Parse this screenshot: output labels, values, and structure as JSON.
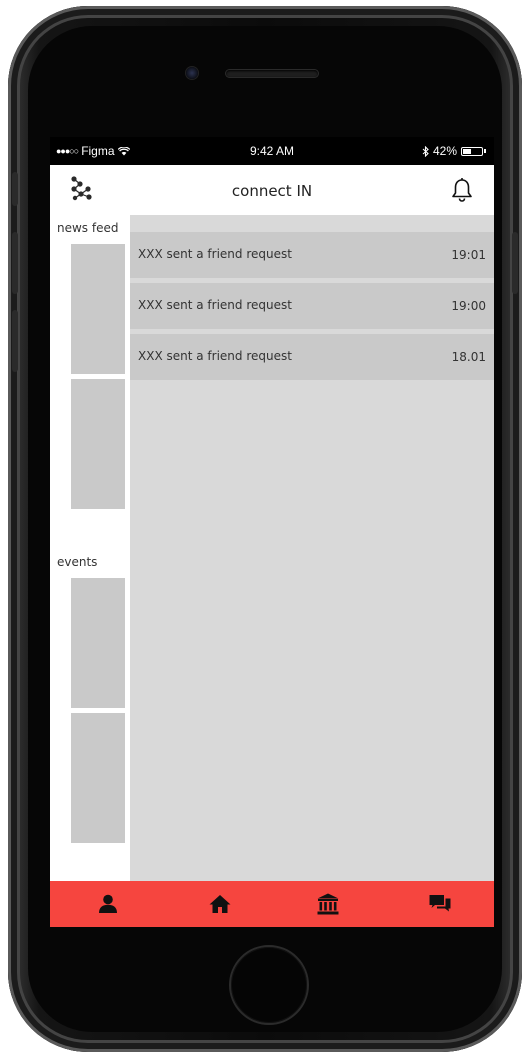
{
  "status_bar": {
    "carrier": "Figma",
    "time": "9:42 AM",
    "battery_percent": "42%",
    "battery_level": 0.42
  },
  "app_bar": {
    "title": "connect IN",
    "logo_icon": "molecule-logo-icon",
    "notifications_icon": "bell-icon"
  },
  "sidebar": {
    "news_feed_label": "news feed",
    "events_label": "events"
  },
  "notifications": [
    {
      "text": "XXX sent a friend request",
      "time": "19:01"
    },
    {
      "text": "XXX sent a friend request",
      "time": "19:00"
    },
    {
      "text": "XXX sent a friend request",
      "time": "18.01"
    }
  ],
  "tab_bar": {
    "color": "#f6453f",
    "tabs": [
      {
        "icon": "profile-icon"
      },
      {
        "icon": "home-icon"
      },
      {
        "icon": "institution-icon"
      },
      {
        "icon": "chat-icon"
      }
    ]
  }
}
